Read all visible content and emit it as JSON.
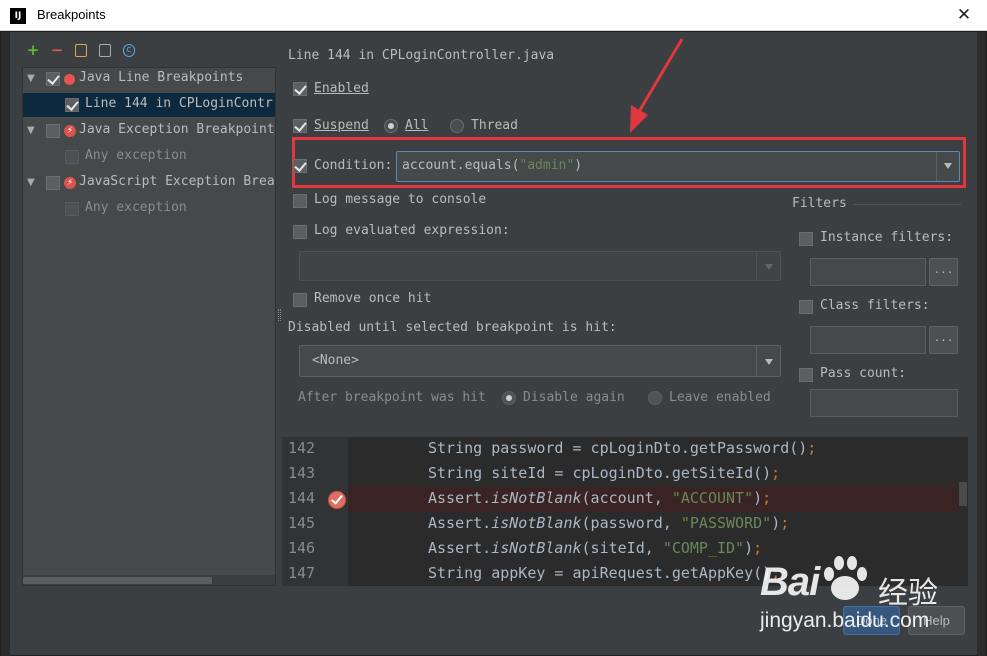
{
  "window": {
    "title": "Breakpoints",
    "close_symbol": "✕"
  },
  "toolbar": {
    "add_icon": "plus-icon",
    "remove_icon": "minus-icon"
  },
  "tree": {
    "groups": [
      {
        "label": "Java Line Breakpoints",
        "checked": true,
        "icon": "red-dot-icon",
        "expanded": true,
        "children": [
          {
            "label": "Line 144 in CPLoginContr",
            "checked": true,
            "selected": true
          }
        ]
      },
      {
        "label": "Java Exception Breakpoint",
        "checked": false,
        "icon": "exception-breakpoint-icon",
        "expanded": true,
        "children": [
          {
            "label": "Any exception",
            "checked": false
          }
        ]
      },
      {
        "label": "JavaScript Exception Brea",
        "checked": false,
        "icon": "exception-breakpoint-icon",
        "expanded": true,
        "children": [
          {
            "label": "Any exception",
            "checked": false
          }
        ]
      }
    ]
  },
  "details": {
    "header": "Line 144 in CPLoginController.java",
    "enabled": {
      "label": "Enabled",
      "checked": true
    },
    "suspend": {
      "label": "Suspend",
      "checked": true
    },
    "suspend_all": {
      "label": "All",
      "selected": true
    },
    "suspend_thread": {
      "label": "Thread",
      "selected": false
    },
    "condition": {
      "label": "Condition:",
      "checked": true,
      "value_prefix": "account.equals(",
      "value_string": "\"admin\"",
      "value_suffix": ")"
    },
    "log_message": {
      "label": "Log message to console",
      "checked": false
    },
    "log_expression": {
      "label": "Log evaluated expression:",
      "checked": false
    },
    "remove_once_hit": {
      "label": "Remove once hit",
      "checked": false
    },
    "disabled_until": {
      "label": "Disabled until selected breakpoint is hit:",
      "selected": "<None>"
    },
    "after_hit": {
      "label": "After breakpoint was hit",
      "disable_again": "Disable again",
      "leave_enabled": "Leave enabled"
    }
  },
  "filters": {
    "title": "Filters",
    "instance": {
      "label": "Instance filters:",
      "checked": false
    },
    "class": {
      "label": "Class filters:",
      "checked": false
    },
    "pass_count": {
      "label": "Pass count:",
      "checked": false
    },
    "browse_label": "..."
  },
  "code": {
    "lines": [
      {
        "num": "142",
        "parts": [
          [
            "String password = cpLoginDto.getPassword()",
            ""
          ],
          [
            ";",
            "sc"
          ]
        ]
      },
      {
        "num": "143",
        "parts": [
          [
            "String siteId = cpLoginDto.getSiteId()",
            ""
          ],
          [
            ";",
            "sc"
          ]
        ]
      },
      {
        "num": "144",
        "breakpoint": true,
        "parts": [
          [
            "Assert.",
            ""
          ],
          [
            "isNotBlank",
            "it"
          ],
          [
            "(account, ",
            ""
          ],
          [
            "\"ACCOUNT\"",
            "str"
          ],
          [
            ")",
            ""
          ],
          [
            ";",
            "sc"
          ]
        ]
      },
      {
        "num": "145",
        "parts": [
          [
            "Assert.",
            ""
          ],
          [
            "isNotBlank",
            "it"
          ],
          [
            "(password, ",
            ""
          ],
          [
            "\"PASSWORD\"",
            "str"
          ],
          [
            ")",
            ""
          ],
          [
            ";",
            "sc"
          ]
        ]
      },
      {
        "num": "146",
        "parts": [
          [
            "Assert.",
            ""
          ],
          [
            "isNotBlank",
            "it"
          ],
          [
            "(siteId, ",
            ""
          ],
          [
            "\"COMP_ID\"",
            "str"
          ],
          [
            ")",
            ""
          ],
          [
            ";",
            "sc"
          ]
        ]
      },
      {
        "num": "147",
        "parts": [
          [
            "String appKey = apiRequest.getAppKey()",
            ""
          ],
          [
            ";",
            "sc"
          ]
        ]
      }
    ]
  },
  "buttons": {
    "done": "Done",
    "help": "Help"
  },
  "watermark": {
    "brand": "Bai",
    "brand_cn": "经验",
    "url": "jingyan.baidu.com"
  },
  "colors": {
    "accent_red": "#e0383e",
    "string_green": "#6a8759",
    "selection_blue": "#0d293e"
  }
}
